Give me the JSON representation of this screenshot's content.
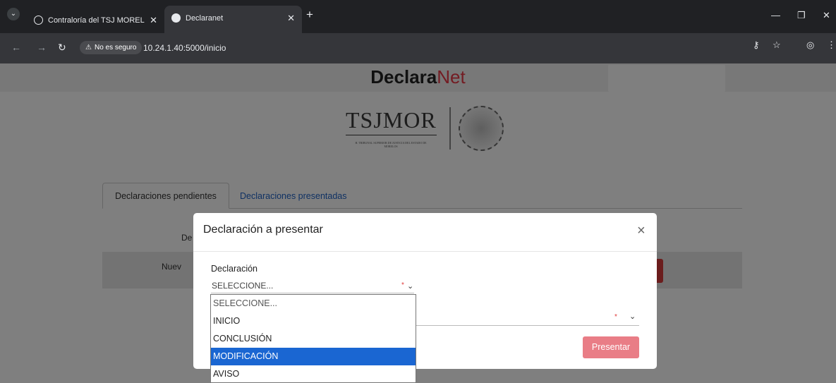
{
  "browser": {
    "tabs": [
      {
        "title": "Contraloría del TSJ MORELOS",
        "active": false
      },
      {
        "title": "Declaranet",
        "active": true
      }
    ],
    "security_label": "No es seguro",
    "url": "10.24.1.40:5000/inicio",
    "icons": {
      "tab_dropdown": "chevron-down-icon",
      "back": "back-arrow-icon",
      "forward": "forward-arrow-icon",
      "reload": "reload-icon",
      "key": "key-icon",
      "bookmark": "star-icon",
      "profile": "profile-icon",
      "menu": "kebab-menu-icon"
    }
  },
  "header": {
    "brand_bold": "Declara",
    "brand_light": "Net"
  },
  "logo": {
    "name": "TSJMOR",
    "subtitle": "H. TRIBUNAL SUPERIOR DE JUSTICIA DEL ESTADO DE MORELOS"
  },
  "page_tabs": [
    {
      "label": "Declaraciones pendientes",
      "active": true
    },
    {
      "label": "Declaraciones presentadas",
      "active": false
    }
  ],
  "background": {
    "row_label_1": "De",
    "row_label_2": "Nuev"
  },
  "modal": {
    "title": "Declaración a presentar",
    "close_symbol": "×",
    "field_label": "Declaración",
    "selected_value": "SELECCIONE...",
    "submit_label": "Presentar"
  },
  "dropdown_options": [
    {
      "label": "SELECCIONE...",
      "highlighted": false
    },
    {
      "label": "INICIO",
      "highlighted": false
    },
    {
      "label": "CONCLUSIÓN",
      "highlighted": false
    },
    {
      "label": "MODIFICACIÓN",
      "highlighted": true
    },
    {
      "label": "AVISO",
      "highlighted": false
    }
  ],
  "colors": {
    "brand_accent": "#e63946",
    "link": "#1f63c6",
    "highlight": "#1a66d2",
    "submit_button": "#e97d86"
  }
}
